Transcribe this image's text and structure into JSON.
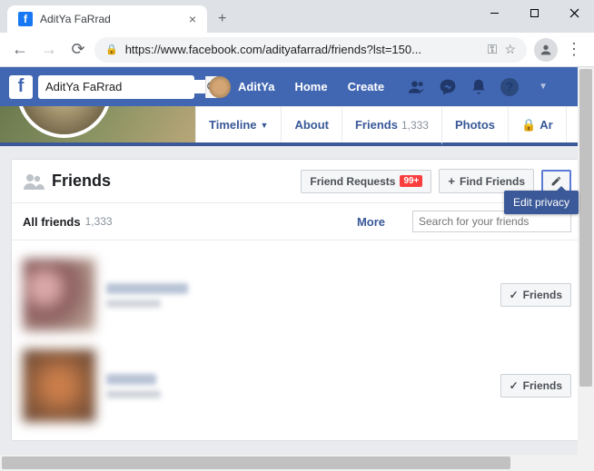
{
  "browser": {
    "tab_title": "AditYa FaRrad",
    "url_display": "https://www.facebook.com/adityafarrad/friends?lst=150..."
  },
  "fb_header": {
    "search_value": "AditYa FaRrad",
    "profile_name": "AditYa",
    "home": "Home",
    "create": "Create"
  },
  "profile_tabs": {
    "timeline": "Timeline",
    "about": "About",
    "friends": "Friends",
    "friends_count": "1,333",
    "photos": "Photos",
    "archive": "Ar"
  },
  "panel": {
    "title": "Friends",
    "friend_requests": "Friend Requests",
    "requests_badge": "99+",
    "find_friends": "Find Friends",
    "tooltip": "Edit privacy"
  },
  "subnav": {
    "all_friends": "All friends",
    "all_count": "1,333",
    "more": "More",
    "search_placeholder": "Search for your friends"
  },
  "friend_button": "Friends"
}
